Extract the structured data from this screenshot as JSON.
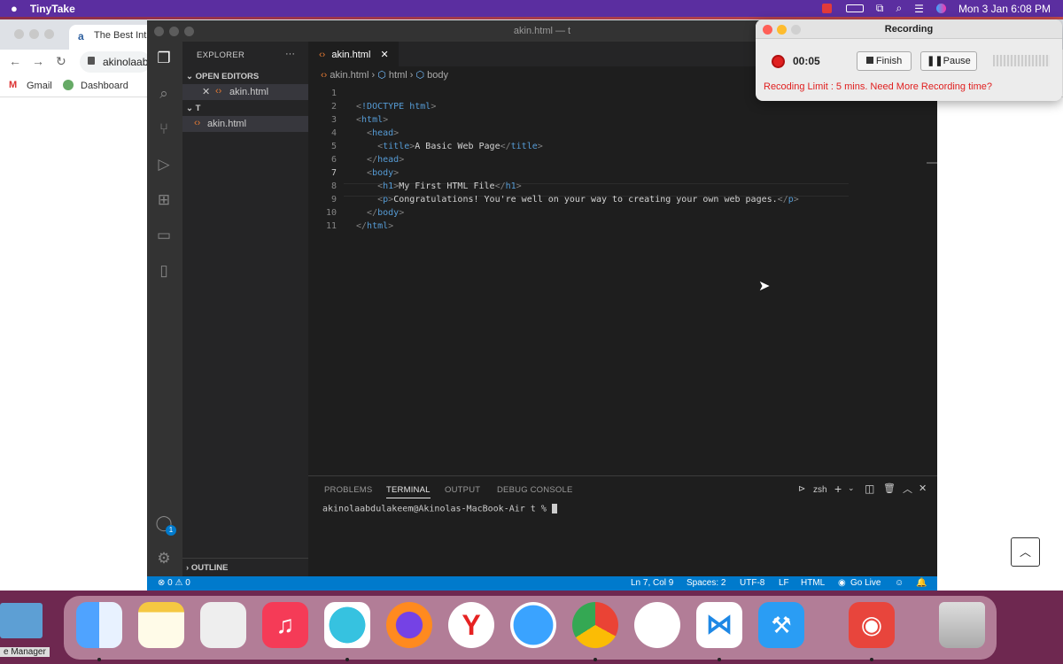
{
  "menubar": {
    "app_name": "TinyTake",
    "datetime": "Mon 3 Jan  6:08 PM"
  },
  "chrome": {
    "tab_title": "The Best Intr",
    "url": "akinolaab",
    "bookmarks": [
      "Gmail",
      "Dashboard"
    ]
  },
  "vscode": {
    "window_title": "akin.html — t",
    "explorer": {
      "title": "EXPLORER",
      "more": "···",
      "open_editors": "OPEN EDITORS",
      "open_file": "akin.html",
      "folder": "T",
      "folder_file": "akin.html",
      "outline": "OUTLINE"
    },
    "tab": {
      "label": "akin.html"
    },
    "breadcrumb": [
      "akin.html",
      "html",
      "body"
    ],
    "code_lines": [
      {
        "n": "1",
        "t": ""
      },
      {
        "n": "2",
        "t": "<!DOCTYPE html>"
      },
      {
        "n": "3",
        "t": "<html>"
      },
      {
        "n": "4",
        "t": "  <head>"
      },
      {
        "n": "5",
        "t": "    <title>A Basic Web Page</title>"
      },
      {
        "n": "6",
        "t": "  </head>"
      },
      {
        "n": "7",
        "t": "  <body>"
      },
      {
        "n": "8",
        "t": "    <h1>My First HTML File</h1>"
      },
      {
        "n": "9",
        "t": "    <p>Congratulations! You're well on your way to creating your own web pages.</p>"
      },
      {
        "n": "10",
        "t": "  </body>"
      },
      {
        "n": "11",
        "t": "</html>"
      }
    ],
    "panel": {
      "tabs": [
        "PROBLEMS",
        "TERMINAL",
        "OUTPUT",
        "DEBUG CONSOLE"
      ],
      "shell": "zsh",
      "prompt": "akinolaabdulakeem@Akinolas-MacBook-Air t %"
    },
    "status": {
      "problems": "⊗ 0 ⚠ 0",
      "position": "Ln 7, Col 9",
      "spaces": "Spaces: 2",
      "encoding": "UTF-8",
      "eol": "LF",
      "language": "HTML",
      "golive": "Go Live"
    },
    "accounts_badge": "1"
  },
  "recording": {
    "title": "Recording",
    "time": "00:05",
    "finish": "Finish",
    "pause": "Pause",
    "limit_text": "Recoding Limit : 5 mins. Need More Recording time?",
    "accent": "#e02020"
  },
  "dock": {
    "left_label": "e Manager"
  }
}
